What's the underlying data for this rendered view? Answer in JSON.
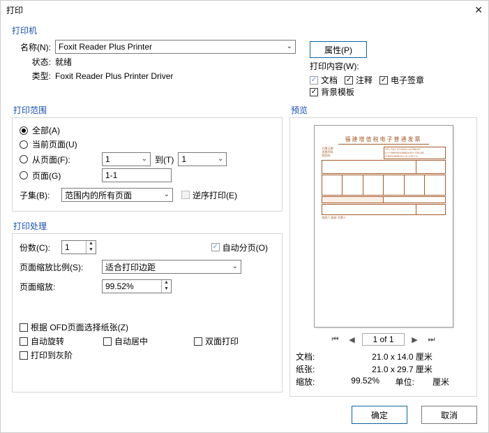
{
  "title": "打印",
  "printer": {
    "name_label": "名称(N):",
    "name_value": "Foxit Reader Plus Printer",
    "status_label": "状态:",
    "status_value": "就绪",
    "type_label": "类型:",
    "type_value": "Foxit Reader Plus Printer Driver",
    "properties_btn": "属性(P)",
    "content_label": "打印内容(W):",
    "doc_label": "文档",
    "annot_label": "注释",
    "esign_label": "电子签章",
    "bg_label": "背景模板"
  },
  "range": {
    "title": "打印范围",
    "all": "全部(A)",
    "current": "当前页面(U)",
    "from_label": "从页面(F):",
    "from_value": "1",
    "to_label": "到(T)",
    "to_value": "1",
    "page_label": "页面(G)",
    "page_value": "1-1",
    "subset_label": "子集(B):",
    "subset_value": "范围内的所有页面",
    "reverse_label": "逆序打印(E)"
  },
  "handling": {
    "title": "打印处理",
    "copies_label": "份数(C):",
    "copies_value": "1",
    "collate_label": "自动分页(O)",
    "scale_mode_label": "页面缩放比例(S):",
    "scale_mode_value": "适合打印边距",
    "scale_label": "页面缩放:",
    "scale_value": "99.52%",
    "ofd_label": "根据 OFD页面选择纸张(Z)",
    "autorotate_label": "自动旋转",
    "autocenter_label": "自动居中",
    "duplex_label": "双面打印",
    "grayscale_label": "打印到灰阶"
  },
  "preview": {
    "title": "预览",
    "nav_label": "1 of 1",
    "doc_label": "文档:",
    "doc_value": "21.0 x 14.0 厘米",
    "paper_label": "纸张:",
    "paper_value": "21.0 x 29.7 厘米",
    "zoom_label": "缩放:",
    "zoom_value": "99.52%",
    "unit_label": "单位:",
    "unit_value": "厘米",
    "invoice_title": "福建增值税电子普通发票"
  },
  "footer": {
    "ok": "确定",
    "cancel": "取消"
  }
}
